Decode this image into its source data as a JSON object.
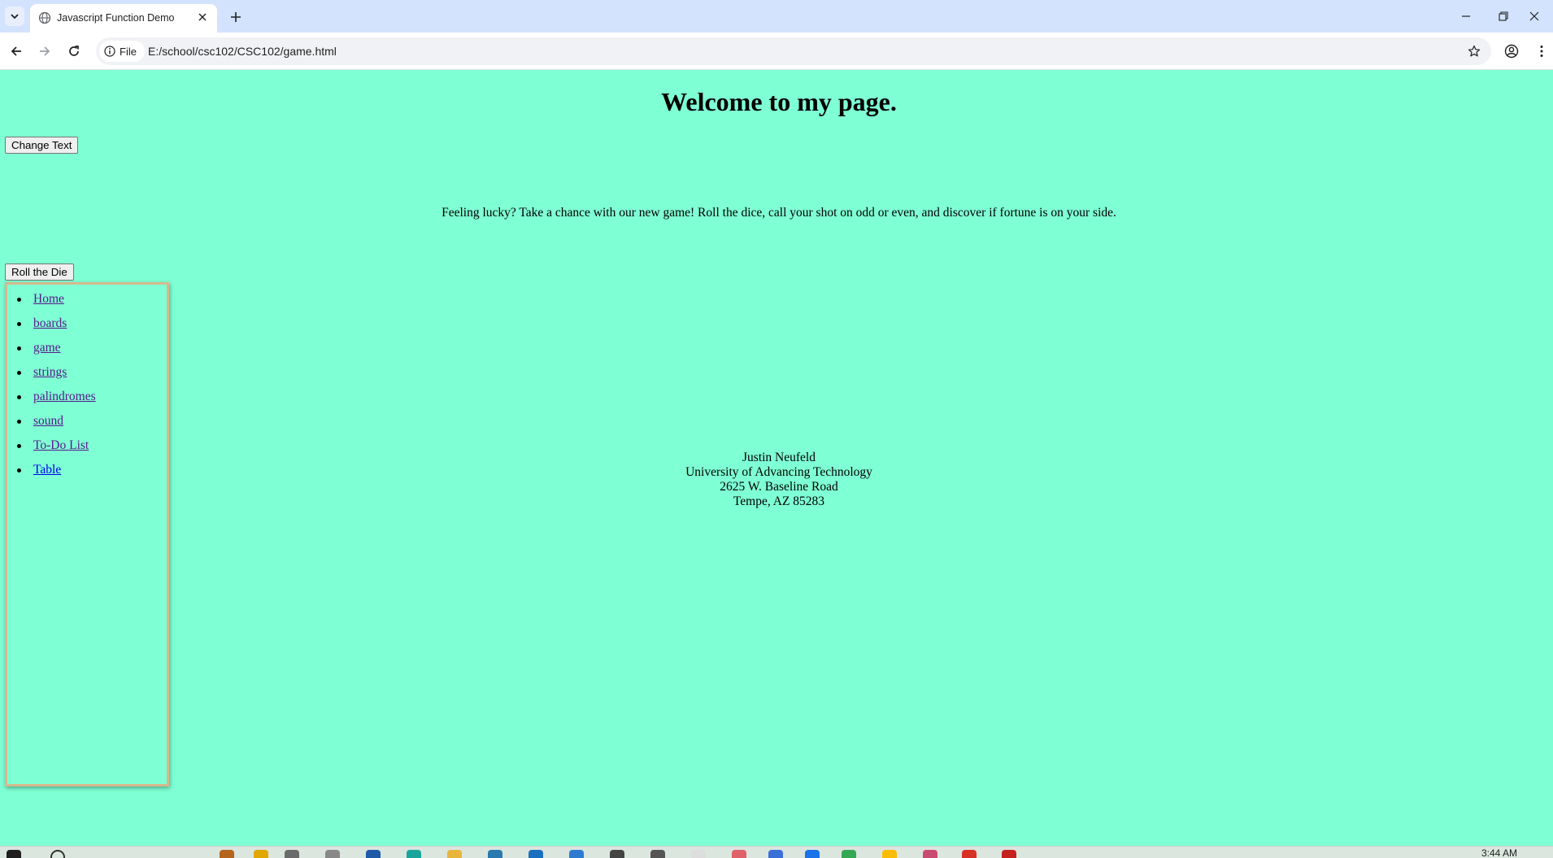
{
  "browser": {
    "tab_title": "Javascript Function Demo",
    "security_chip_label": "File",
    "url": "E:/school/csc102/CSC102/game.html"
  },
  "page": {
    "heading": "Welcome to my page.",
    "change_text_button": "Change Text",
    "intro_text": "Feeling lucky? Take a chance with our new game! Roll the dice, call your shot on odd or even, and discover if fortune is on your side.",
    "roll_button": "Roll the Die",
    "nav_links": [
      "Home",
      "boards",
      "game",
      "strings",
      "palindromes",
      "sound",
      "To-Do List",
      "Table"
    ],
    "address": {
      "name": "Justin Neufeld",
      "org": "University of Advancing Technology",
      "street": "2625 W. Baseline Road",
      "city": "Tempe, AZ 85283"
    }
  },
  "taskbar": {
    "clock": "3:44 AM"
  },
  "colors": {
    "page_background": "#7fffd4",
    "nav_border": "#d6b98e",
    "visited_link": "#551a8b",
    "unvisited_link": "#0000ee"
  }
}
